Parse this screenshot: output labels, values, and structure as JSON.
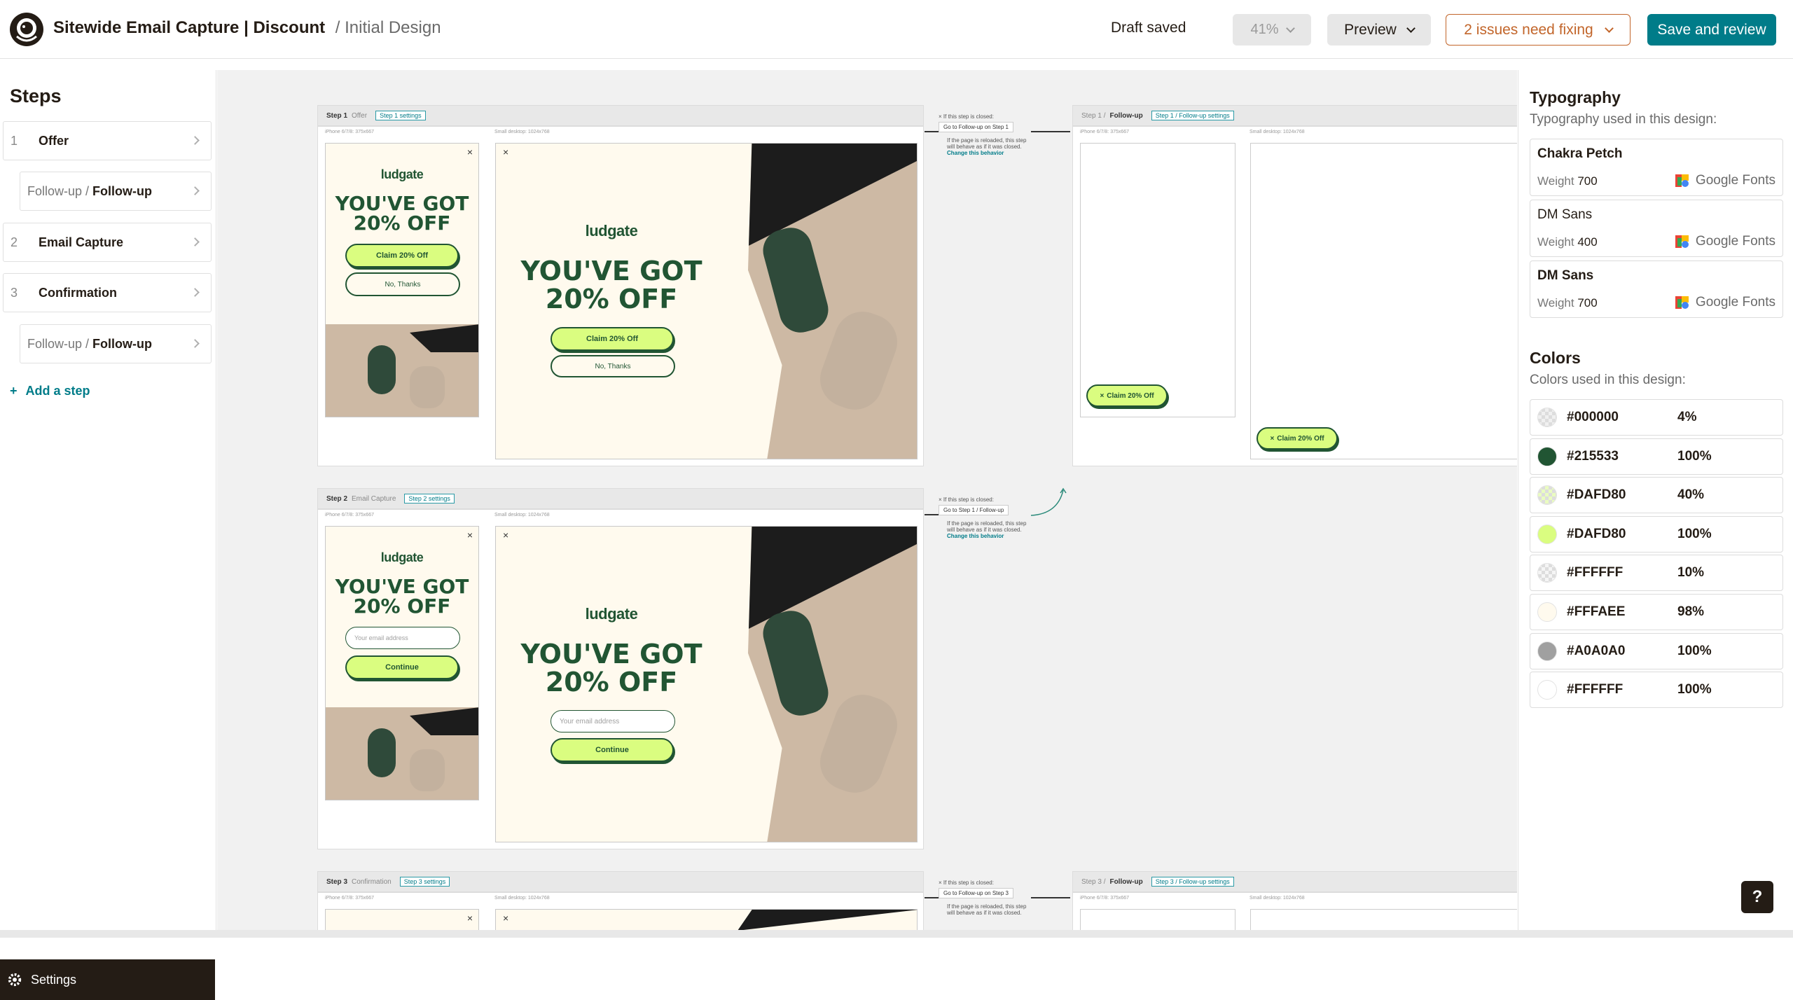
{
  "header": {
    "title": "Sitewide Email Capture | Discount",
    "subtitle": "/ Initial Design",
    "draft_status": "Draft saved",
    "zoom": "41%",
    "preview_label": "Preview",
    "issues_label": "2 issues need fixing",
    "save_label": "Save and review"
  },
  "sidebar": {
    "heading": "Steps",
    "items": [
      {
        "num": "1",
        "label": "Offer"
      },
      {
        "prefix": "Follow-up /",
        "label": "Follow-up"
      },
      {
        "num": "2",
        "label": "Email Capture"
      },
      {
        "num": "3",
        "label": "Confirmation"
      },
      {
        "prefix": "Follow-up /",
        "label": "Follow-up"
      }
    ],
    "add_step": "Add a step",
    "settings": "Settings"
  },
  "canvas": {
    "step1": {
      "title": "Step 1",
      "name": "Offer",
      "tag": "Step 1 settings",
      "mobile_label": "iPhone 6/7/8: 375x667",
      "desktop_label": "Small desktop: 1024x768"
    },
    "step1_follow": {
      "title": "Step 1 /",
      "name": "Follow-up",
      "tag": "Step 1 / Follow-up settings",
      "mobile_label": "iPhone 6/7/8: 375x667",
      "desktop_label": "Small desktop: 1024x768"
    },
    "step2": {
      "title": "Step 2",
      "name": "Email Capture",
      "tag": "Step 2 settings",
      "mobile_label": "iPhone 6/7/8: 375x667",
      "desktop_label": "Small desktop: 1024x768"
    },
    "step3": {
      "title": "Step 3",
      "name": "Confirmation",
      "tag": "Step 3 settings",
      "mobile_label": "iPhone 6/7/8: 375x667",
      "desktop_label": "Small desktop: 1024x768"
    },
    "step3_follow": {
      "title": "Step 3 /",
      "name": "Follow-up",
      "tag": "Step 3 / Follow-up settings",
      "mobile_label": "iPhone 6/7/8: 375x667",
      "desktop_label": "Small desktop: 1024x768"
    },
    "brand": "ludgate",
    "headline_1": "YOU'VE GOT",
    "headline_2": "20% OFF",
    "claim": "Claim 20% Off",
    "no_thanks": "No, Thanks",
    "email_placeholder": "Your email address",
    "continue": "Continue",
    "closed_text": "If this step is closed:",
    "go_follow1": "Go to Follow-up on Step 1",
    "go_step1_follow": "Go to Step 1 / Follow-up",
    "go_follow3": "Go to Follow-up on Step 3",
    "reload_text_1": "If the page is reloaded, this step",
    "reload_text_2": "will behave as if it was closed.",
    "change_behavior": "Change this behavior"
  },
  "panel": {
    "typography_heading": "Typography",
    "typography_desc": "Typography used in this design:",
    "fonts": [
      {
        "name": "Chakra Petch",
        "weight_label": "Weight",
        "weight": "700",
        "source": "Google Fonts"
      },
      {
        "name": "DM Sans",
        "weight_label": "Weight",
        "weight": "400",
        "source": "Google Fonts"
      },
      {
        "name": "DM Sans",
        "weight_label": "Weight",
        "weight": "700",
        "source": "Google Fonts"
      }
    ],
    "colors_heading": "Colors",
    "colors_desc": "Colors used in this design:",
    "colors": [
      {
        "hex": "#000000",
        "opacity": "4%",
        "swatch": "#000000"
      },
      {
        "hex": "#215533",
        "opacity": "100%",
        "swatch": "#215533"
      },
      {
        "hex": "#DAFD80",
        "opacity": "40%",
        "swatch": "#DAFD80"
      },
      {
        "hex": "#DAFD80",
        "opacity": "100%",
        "swatch": "#DAFD80"
      },
      {
        "hex": "#FFFFFF",
        "opacity": "10%",
        "swatch": "#FFFFFF"
      },
      {
        "hex": "#FFFAEE",
        "opacity": "98%",
        "swatch": "#FFFAEE"
      },
      {
        "hex": "#A0A0A0",
        "opacity": "100%",
        "swatch": "#A0A0A0"
      },
      {
        "hex": "#FFFFFF",
        "opacity": "100%",
        "swatch": "#FFFFFF"
      }
    ]
  },
  "help_label": "?"
}
